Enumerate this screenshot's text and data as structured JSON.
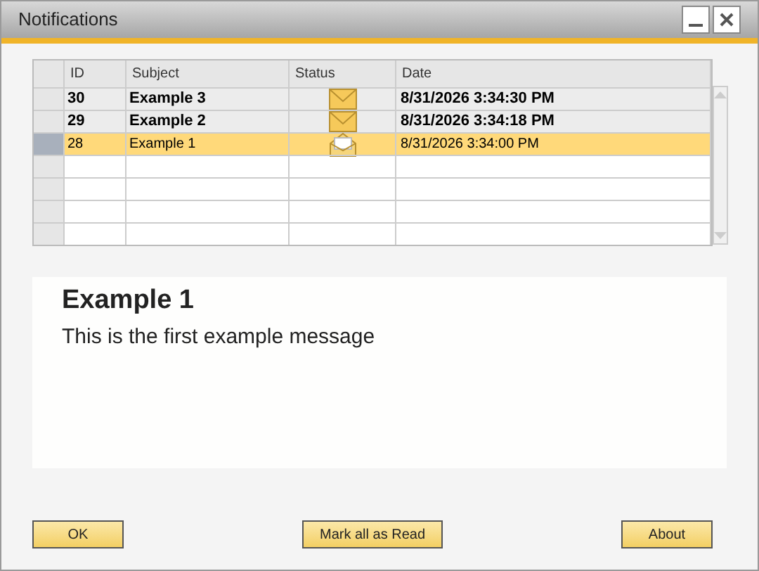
{
  "window": {
    "title": "Notifications"
  },
  "table": {
    "columns": [
      "ID",
      "Subject",
      "Status",
      "Date"
    ],
    "rows": [
      {
        "id": "30",
        "subject": "Example 3",
        "read": false,
        "date": "8/31/2026 3:34:30 PM",
        "selected": false
      },
      {
        "id": "29",
        "subject": "Example 2",
        "read": false,
        "date": "8/31/2026 3:34:18 PM",
        "selected": false
      },
      {
        "id": "28",
        "subject": "Example 1",
        "read": true,
        "date": "8/31/2026 3:34:00 PM",
        "selected": true
      }
    ]
  },
  "message": {
    "title": "Example 1",
    "body": "This is the first example message"
  },
  "buttons": [
    "OK",
    "Mark all as Read",
    "About"
  ]
}
